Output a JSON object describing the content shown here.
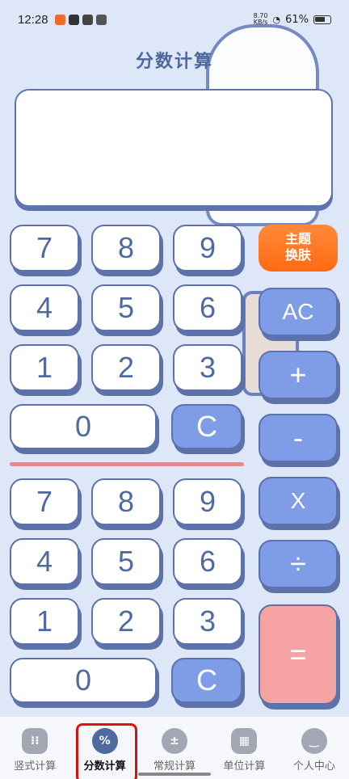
{
  "status": {
    "time": "12:28",
    "speed": "8.70\nKB/s",
    "battery": "61%"
  },
  "header": {
    "title": "分数计算"
  },
  "theme_button": {
    "line1": "主题",
    "line2": "换肤"
  },
  "top_keypad": [
    "7",
    "8",
    "9",
    "4",
    "5",
    "6",
    "1",
    "2",
    "3",
    "0",
    "C"
  ],
  "bottom_keypad": [
    "7",
    "8",
    "9",
    "4",
    "5",
    "6",
    "1",
    "2",
    "3",
    "0",
    "C"
  ],
  "operators": {
    "ac": "AC",
    "plus": "+",
    "minus": "-",
    "times": "X",
    "divide": "÷",
    "equals": "="
  },
  "tabs": [
    {
      "label": "竖式计算",
      "icon": "keypad-icon",
      "active": false
    },
    {
      "label": "分数计算",
      "icon": "percent-icon",
      "glyph": "%",
      "active": true
    },
    {
      "label": "常规计算",
      "icon": "calculator-icon",
      "active": false
    },
    {
      "label": "单位计算",
      "icon": "grid-icon",
      "active": false
    },
    {
      "label": "个人中心",
      "icon": "smile-icon",
      "active": false
    }
  ],
  "colors": {
    "accent": "#4f6aa0",
    "operator": "#7f9ce6",
    "equals": "#f6a3a3",
    "theme_button": "#ff7a22"
  }
}
